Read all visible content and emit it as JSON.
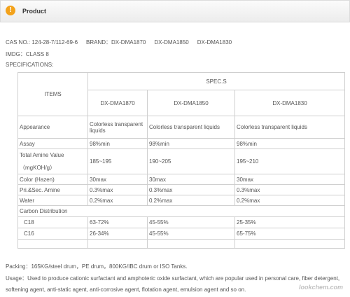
{
  "header": {
    "title": "Product",
    "icon": "warning-icon"
  },
  "info": {
    "cas": "CAS NO.: 124-28-7/112-69-6",
    "brand": "BRAND：DX-DMA1870",
    "brand2": "DX-DMA1850",
    "brand3": "DX-DMA1830",
    "imdg": "IMDG：CLASS 8",
    "specifications": "SPECIFICATIONS:"
  },
  "table": {
    "items_header": "ITEMS",
    "spec_header": "SPEC.S",
    "products": [
      "DX-DMA1870",
      "DX-DMA1850",
      "DX-DMA1830"
    ],
    "rows": [
      {
        "label": "Appearance",
        "values": [
          "Colorless transparent liquids",
          "Colorless transparent liquids",
          "Colorless transparent liquids"
        ]
      },
      {
        "label": "Assay",
        "values": [
          "98%min",
          "98%min",
          "98%min"
        ]
      },
      {
        "label": "Total Amine Value",
        "label2": "（mgKOH/g）",
        "values": [
          "185~195",
          "190~205",
          "195~210"
        ]
      },
      {
        "label": "Color (Hazen)",
        "values": [
          "30max",
          "30max",
          "30max"
        ]
      },
      {
        "label": "Pri.&Sec. Amine",
        "values": [
          "0.3%max",
          "0.3%max",
          "0.3%max"
        ]
      },
      {
        "label": "Water",
        "values": [
          "0.2%max",
          "0.2%max",
          "0.2%max"
        ]
      }
    ],
    "carbon_label": "Carbon Distribution",
    "carbon": [
      {
        "label": "C18",
        "values": [
          "63-72%",
          "45-55%",
          "25-35%"
        ]
      },
      {
        "label": "C16",
        "values": [
          "26-34%",
          "45-55%",
          "65-75%"
        ]
      }
    ]
  },
  "packing": "Packing：165KG/steel drum，PE drum，800KG/IBC drum or ISO Tanks.",
  "usage": "Usage：Used to produce cationic surfactant and amphoteric oxide surfactant, which are popular used in personal care, fiber detergent, softening agent, anti-static agent, anti-corrosive agent, flotation agent, emulsion agent and so on.",
  "watermark": "lookchem.com"
}
